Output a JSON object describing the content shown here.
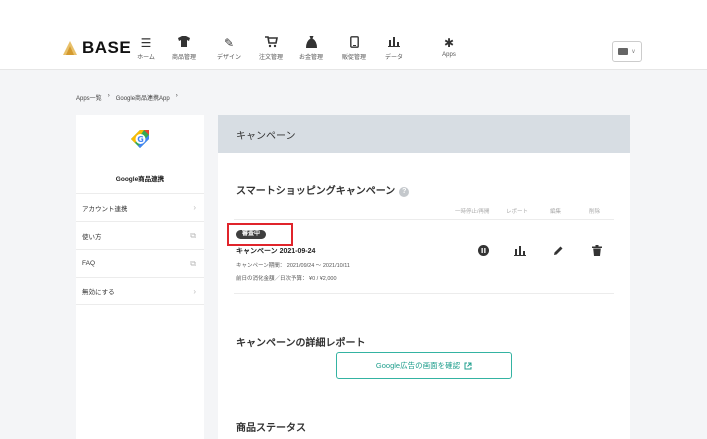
{
  "header": {
    "logo_text": "BASE",
    "nav": [
      {
        "label": "ホーム",
        "icon": "menu-icon"
      },
      {
        "label": "商品管理",
        "icon": "shirt-icon"
      },
      {
        "label": "デザイン",
        "icon": "brush-icon"
      },
      {
        "label": "注文管理",
        "icon": "cart-icon"
      },
      {
        "label": "お金管理",
        "icon": "money-bag-icon"
      },
      {
        "label": "販促管理",
        "icon": "phone-icon"
      },
      {
        "label": "データ",
        "icon": "bar-chart-icon"
      },
      {
        "label": "Apps",
        "icon": "puzzle-icon"
      }
    ]
  },
  "breadcrumb": {
    "items": [
      "Apps一覧",
      "Google商品連携App"
    ],
    "separator": "›"
  },
  "sidebar": {
    "title": "Google商品連携",
    "items": [
      {
        "label": "アカウント連携",
        "icon": "›"
      },
      {
        "label": "使い方",
        "icon": "⧉"
      },
      {
        "label": "FAQ",
        "icon": "⧉"
      },
      {
        "label": "無効にする",
        "icon": "›"
      }
    ]
  },
  "main": {
    "header": "キャンペーン",
    "smart_title": "スマートショッピングキャンペーン",
    "help_icon": "?",
    "columns": [
      "一時停止/再開",
      "レポート",
      "編集",
      "削除"
    ],
    "campaign": {
      "status": "審査中",
      "name": "キャンペーン 2021-09-24",
      "period": "キャンペーン期間： 2021/09/24 〜 2021/10/11",
      "budget": "前日の消化金額／日次予算： ¥0 / ¥2,000"
    },
    "report_title": "キャンペーンの詳細レポート",
    "report_button": "Google広告の画面を確認",
    "product_title": "商品ステータス"
  },
  "colors": {
    "accent": "#34b3a2",
    "highlight": "#e0242b",
    "panel_header": "#d7dde3"
  }
}
